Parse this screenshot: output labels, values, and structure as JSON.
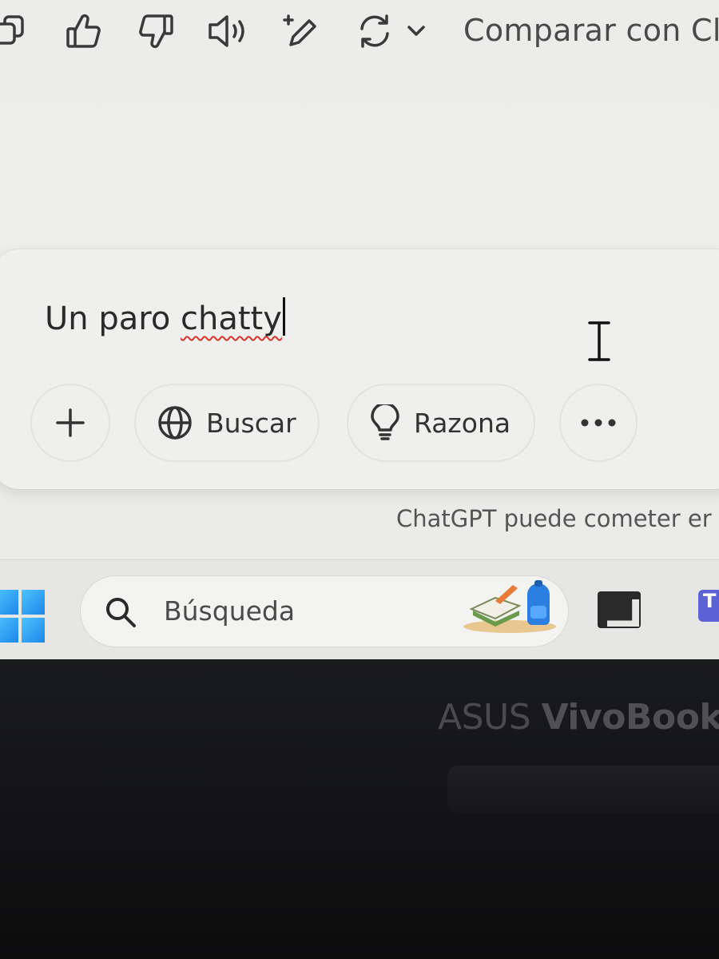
{
  "toolbar": {
    "compare_label": "Comparar con Cla",
    "icons": [
      "copy-icon",
      "thumbs-up-icon",
      "thumbs-down-icon",
      "speaker-icon",
      "edit-icon",
      "regenerate-icon",
      "chevron-down-icon"
    ]
  },
  "composer": {
    "text_before": "Un paro ",
    "text_misspelled": "chatty",
    "buttons": {
      "add_icon": "plus-icon",
      "search_label": "Buscar",
      "search_icon": "globe-icon",
      "reason_label": "Razona",
      "reason_icon": "lightbulb-icon",
      "more_icon": "ellipsis-icon"
    }
  },
  "disclaimer": "ChatGPT puede cometer er",
  "taskbar": {
    "search_placeholder": "Búsqueda",
    "apps": [
      "windows-start-icon",
      "widgets-icon",
      "dark-app-icon",
      "teams-icon"
    ],
    "teams_letter": "T"
  },
  "device": {
    "brand_light": "ASUS ",
    "brand_bold": "VivoBook"
  },
  "colors": {
    "screen_bg": "#eeeeec",
    "spellcheck_underline": "#d9342b",
    "windows_blue": "#1f86e8",
    "bezel": "#121214"
  }
}
